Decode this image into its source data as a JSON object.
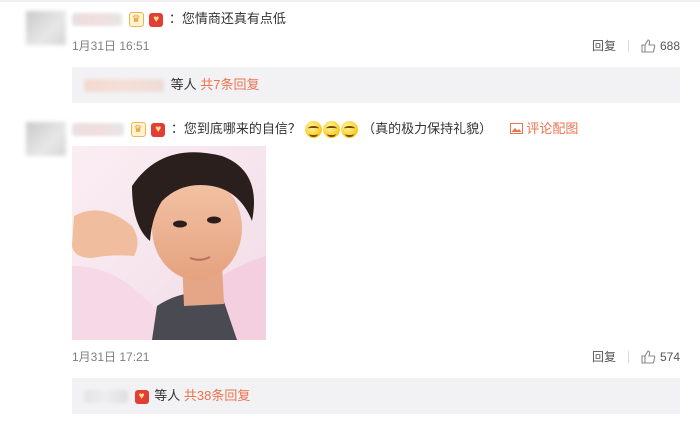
{
  "comments": [
    {
      "text": "：您情商还真有点低",
      "time": "1月31日 16:51",
      "reply_label": "回复",
      "likes": "688",
      "summary": {
        "suffix": "等人",
        "link": "共7条回复"
      }
    },
    {
      "text": "：您到底哪来的自信？",
      "trailing_text": "（真的极力保持礼貌）",
      "image_link": "评论配图",
      "time": "1月31日 17:21",
      "reply_label": "回复",
      "likes": "574",
      "summary": {
        "suffix": "等人",
        "link": "共38条回复"
      }
    }
  ],
  "icons": {
    "crown_badge": "crown-badge-icon",
    "vip_badge": "vip-heart-badge-icon",
    "like": "thumbs-up-icon",
    "picture": "picture-icon",
    "emoji": "smiling-face-emoji-icon"
  },
  "colors": {
    "accent": "#eb7350",
    "meta": "#808080",
    "summary_bg": "#f2f2f5"
  }
}
